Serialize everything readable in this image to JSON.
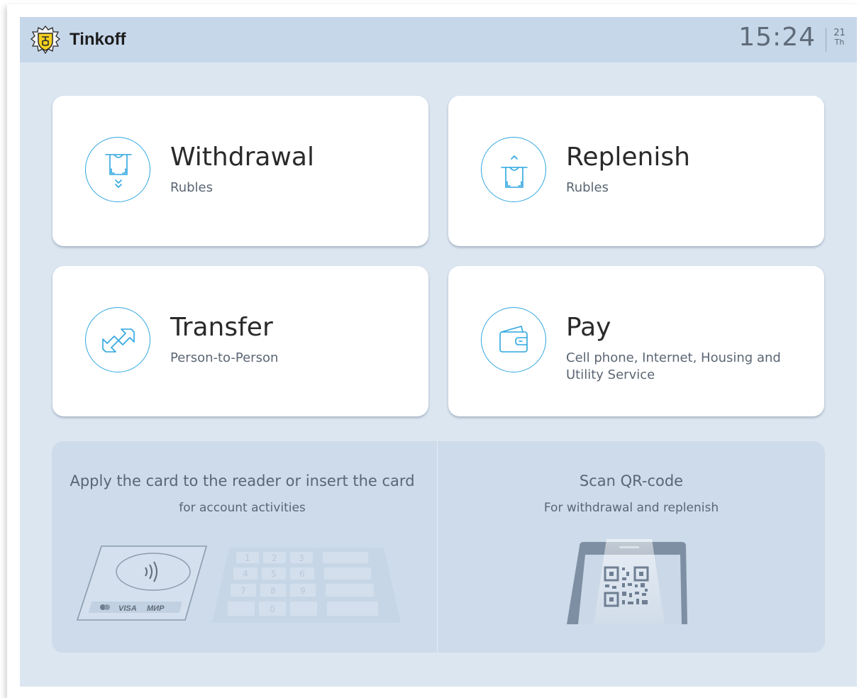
{
  "header": {
    "brand": "Tinkoff",
    "time": "15:24",
    "day": "21",
    "weekday": "Th"
  },
  "cards": [
    {
      "title": "Withdrawal",
      "subtitle": "Rubles",
      "icon": "cash-withdraw-icon"
    },
    {
      "title": "Replenish",
      "subtitle": "Rubles",
      "icon": "cash-deposit-icon"
    },
    {
      "title": "Transfer",
      "subtitle": "Person-to-Person",
      "icon": "transfer-arrows-icon"
    },
    {
      "title": "Pay",
      "subtitle": "Cell phone, Internet, Housing and Utility Service",
      "icon": "wallet-icon"
    }
  ],
  "card_panel": {
    "title": "Apply the card to the reader or insert the card",
    "subtitle": "for account activities",
    "card_brands": [
      "VISA",
      "МИР"
    ],
    "keypad": [
      "1",
      "2",
      "3",
      "4",
      "5",
      "6",
      "7",
      "8",
      "9",
      "0"
    ]
  },
  "qr_panel": {
    "title": "Scan QR-code",
    "subtitle": "For withdrawal and replenish"
  },
  "colors": {
    "accent": "#2fa6df",
    "background": "#dce6f1",
    "header": "#c6d7ea",
    "panel": "#cddbea"
  }
}
